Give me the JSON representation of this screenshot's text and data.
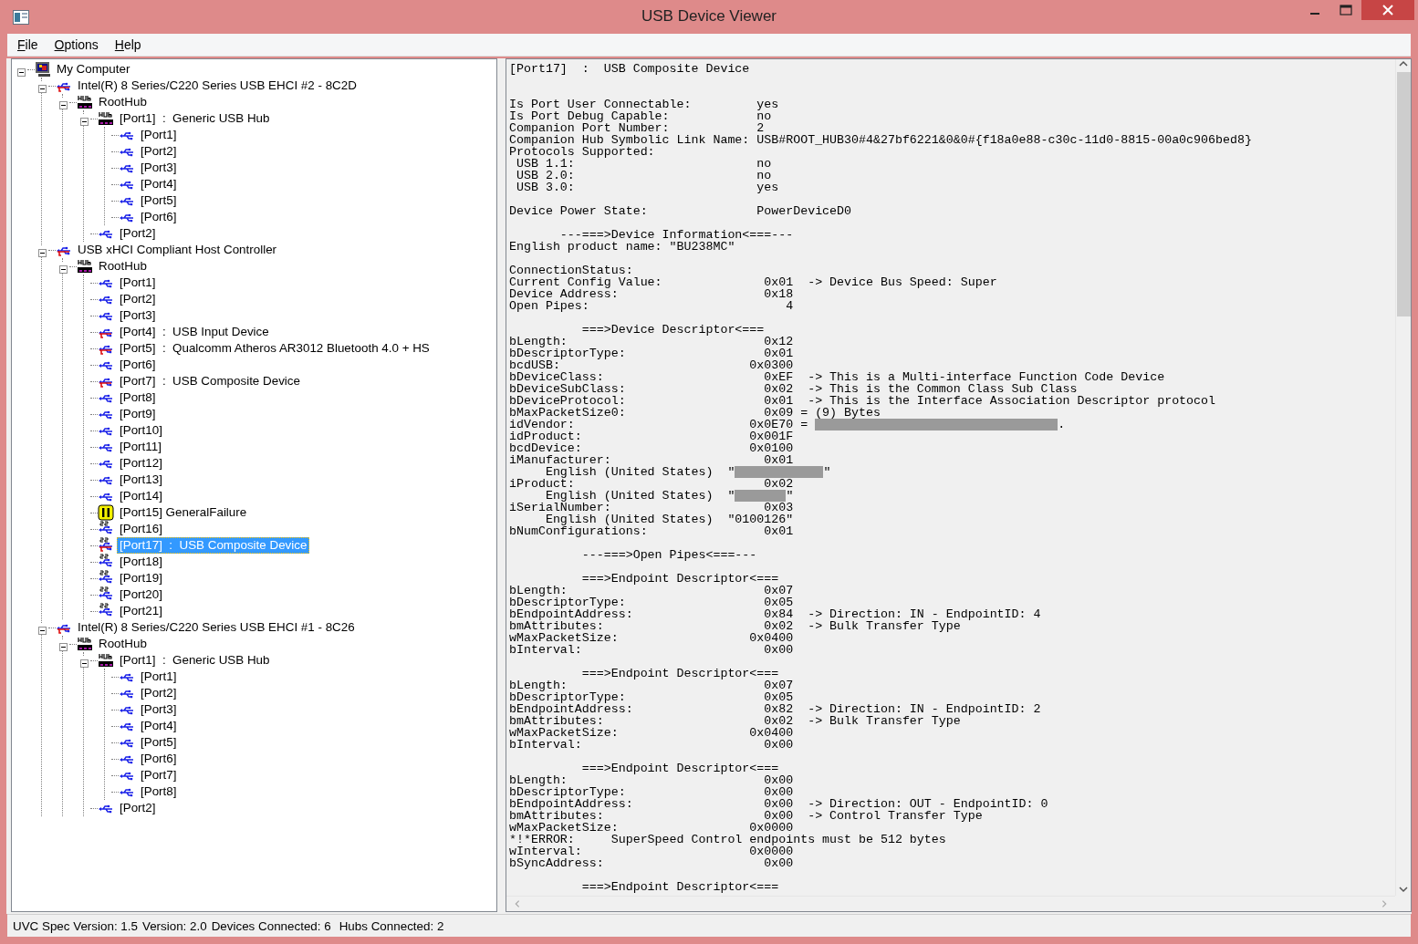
{
  "window": {
    "title": "USB Device Viewer"
  },
  "menu": [
    {
      "label": "File"
    },
    {
      "label": "Options"
    },
    {
      "label": "Help"
    }
  ],
  "tree": [
    {
      "label": "My Computer",
      "kind": "computer",
      "selected": false,
      "expanded": true,
      "children": [
        {
          "label": "Intel(R) 8 Series/C220 Series USB EHCI #2 - 8C2D",
          "kind": "controller",
          "selected": false,
          "expanded": true,
          "children": [
            {
              "label": "RootHub",
              "kind": "hub",
              "selected": false,
              "expanded": true,
              "children": [
                {
                  "label": "[Port1]  :  Generic USB Hub",
                  "kind": "hub",
                  "selected": false,
                  "expanded": true,
                  "children": [
                    {
                      "label": "[Port1]",
                      "kind": "port",
                      "selected": false
                    },
                    {
                      "label": "[Port2]",
                      "kind": "port",
                      "selected": false
                    },
                    {
                      "label": "[Port3]",
                      "kind": "port",
                      "selected": false
                    },
                    {
                      "label": "[Port4]",
                      "kind": "port",
                      "selected": false
                    },
                    {
                      "label": "[Port5]",
                      "kind": "port",
                      "selected": false
                    },
                    {
                      "label": "[Port6]",
                      "kind": "port",
                      "selected": false
                    }
                  ]
                },
                {
                  "label": "[Port2]",
                  "kind": "port",
                  "selected": false
                }
              ]
            }
          ]
        },
        {
          "label": "USB xHCI Compliant Host Controller",
          "kind": "controller",
          "selected": false,
          "expanded": true,
          "children": [
            {
              "label": "RootHub",
              "kind": "hub",
              "selected": false,
              "expanded": true,
              "children": [
                {
                  "label": "[Port1]",
                  "kind": "port",
                  "selected": false
                },
                {
                  "label": "[Port2]",
                  "kind": "port",
                  "selected": false
                },
                {
                  "label": "[Port3]",
                  "kind": "port",
                  "selected": false
                },
                {
                  "label": "[Port4]  :  USB Input Device",
                  "kind": "device",
                  "selected": false
                },
                {
                  "label": "[Port5]  :  Qualcomm Atheros AR3012 Bluetooth 4.0 + HS",
                  "kind": "device",
                  "selected": false
                },
                {
                  "label": "[Port6]",
                  "kind": "port",
                  "selected": false
                },
                {
                  "label": "[Port7]  :  USB Composite Device",
                  "kind": "device",
                  "selected": false
                },
                {
                  "label": "[Port8]",
                  "kind": "port",
                  "selected": false
                },
                {
                  "label": "[Port9]",
                  "kind": "port",
                  "selected": false
                },
                {
                  "label": "[Port10]",
                  "kind": "port",
                  "selected": false
                },
                {
                  "label": "[Port11]",
                  "kind": "port",
                  "selected": false
                },
                {
                  "label": "[Port12]",
                  "kind": "port",
                  "selected": false
                },
                {
                  "label": "[Port13]",
                  "kind": "port",
                  "selected": false
                },
                {
                  "label": "[Port14]",
                  "kind": "port",
                  "selected": false
                },
                {
                  "label": "[Port15] GeneralFailure",
                  "kind": "failure",
                  "selected": false
                },
                {
                  "label": "[Port16]",
                  "kind": "ss-port",
                  "selected": false
                },
                {
                  "label": "[Port17]  :  USB Composite Device",
                  "kind": "ss-device",
                  "selected": true
                },
                {
                  "label": "[Port18]",
                  "kind": "ss-port",
                  "selected": false
                },
                {
                  "label": "[Port19]",
                  "kind": "ss-port",
                  "selected": false
                },
                {
                  "label": "[Port20]",
                  "kind": "ss-port",
                  "selected": false
                },
                {
                  "label": "[Port21]",
                  "kind": "ss-port",
                  "selected": false
                }
              ]
            }
          ]
        },
        {
          "label": "Intel(R) 8 Series/C220 Series USB EHCI #1 - 8C26",
          "kind": "controller",
          "selected": false,
          "expanded": true,
          "children": [
            {
              "label": "RootHub",
              "kind": "hub",
              "selected": false,
              "expanded": true,
              "children": [
                {
                  "label": "[Port1]  :  Generic USB Hub",
                  "kind": "hub",
                  "selected": false,
                  "expanded": true,
                  "children": [
                    {
                      "label": "[Port1]",
                      "kind": "port",
                      "selected": false
                    },
                    {
                      "label": "[Port2]",
                      "kind": "port",
                      "selected": false
                    },
                    {
                      "label": "[Port3]",
                      "kind": "port",
                      "selected": false
                    },
                    {
                      "label": "[Port4]",
                      "kind": "port",
                      "selected": false
                    },
                    {
                      "label": "[Port5]",
                      "kind": "port",
                      "selected": false
                    },
                    {
                      "label": "[Port6]",
                      "kind": "port",
                      "selected": false
                    },
                    {
                      "label": "[Port7]",
                      "kind": "port",
                      "selected": false
                    },
                    {
                      "label": "[Port8]",
                      "kind": "port",
                      "selected": false
                    }
                  ]
                },
                {
                  "label": "[Port2]",
                  "kind": "port",
                  "selected": false
                }
              ]
            }
          ]
        }
      ]
    }
  ],
  "report": {
    "sections": [
      {
        "kind": "header",
        "lines": [
          {
            "text": "[Port17]  :  USB Composite Device"
          }
        ]
      },
      {
        "kind": "body",
        "lines": [
          {
            "text": "Is Port User Connectable:         yes"
          },
          {
            "text": "Is Port Debug Capable:            no"
          },
          {
            "text": "Companion Port Number:            2"
          },
          {
            "text": "Companion Hub Symbolic Link Name: USB#ROOT_HUB30#4&27bf6221&0&0#{f18a0e88-c30c-11d0-8815-00a0c906bed8}"
          },
          {
            "text": "Protocols Supported:"
          },
          {
            "text": " USB 1.1:                         no"
          },
          {
            "text": " USB 2.0:                         no"
          },
          {
            "text": " USB 3.0:                         yes"
          }
        ]
      },
      {
        "kind": "body",
        "lines": [
          {
            "text": "Device Power State:               PowerDeviceD0"
          }
        ]
      },
      {
        "kind": "body",
        "lines": [
          {
            "text": "       ---===>Device Information<===---"
          },
          {
            "text": "English product name: \"BU238MC\""
          }
        ]
      },
      {
        "kind": "body",
        "lines": [
          {
            "text": "ConnectionStatus:"
          },
          {
            "text": "Current Config Value:              0x01  -> Device Bus Speed: Super"
          },
          {
            "text": "Device Address:                    0x18"
          },
          {
            "text": "Open Pipes:                           4"
          }
        ]
      },
      {
        "kind": "body",
        "lines": [
          {
            "text": "          ===>Device Descriptor<==="
          },
          {
            "text": "bLength:                           0x12"
          },
          {
            "text": "bDescriptorType:                   0x01"
          },
          {
            "text": "bcdUSB:                          0x0300"
          },
          {
            "text": "bDeviceClass:                      0xEF  -> This is a Multi-interface Function Code Device"
          },
          {
            "text": "bDeviceSubClass:                   0x02  -> This is the Common Class Sub Class"
          },
          {
            "text": "bDeviceProtocol:                   0x01  -> This is the Interface Association Descriptor protocol"
          },
          {
            "text": "bMaxPacketSize0:                   0x09 = (9) Bytes"
          },
          {
            "text": "idVendor:                        0x0E70 = ",
            "kind": "redacted-long",
            "after": "."
          },
          {
            "text": "idProduct:                       0x001F"
          },
          {
            "text": "bcdDevice:                       0x0100"
          },
          {
            "text": "iManufacturer:                     0x01"
          },
          {
            "text": "     English (United States)  \"",
            "kind": "redacted-medium",
            "after": "\""
          },
          {
            "text": "iProduct:                          0x02"
          },
          {
            "text": "     English (United States)  \"",
            "kind": "redacted-short",
            "after": "\""
          },
          {
            "text": "iSerialNumber:                     0x03"
          },
          {
            "text": "     English (United States)  \"0100126\""
          },
          {
            "text": "bNumConfigurations:                0x01"
          }
        ]
      },
      {
        "kind": "body",
        "lines": [
          {
            "text": "          ---===>Open Pipes<===---"
          }
        ]
      },
      {
        "kind": "body",
        "lines": [
          {
            "text": "          ===>Endpoint Descriptor<==="
          },
          {
            "text": "bLength:                           0x07"
          },
          {
            "text": "bDescriptorType:                   0x05"
          },
          {
            "text": "bEndpointAddress:                  0x84  -> Direction: IN - EndpointID: 4"
          },
          {
            "text": "bmAttributes:                      0x02  -> Bulk Transfer Type"
          },
          {
            "text": "wMaxPacketSize:                  0x0400"
          },
          {
            "text": "bInterval:                         0x00"
          }
        ]
      },
      {
        "kind": "body",
        "lines": [
          {
            "text": "          ===>Endpoint Descriptor<==="
          },
          {
            "text": "bLength:                           0x07"
          },
          {
            "text": "bDescriptorType:                   0x05"
          },
          {
            "text": "bEndpointAddress:                  0x82  -> Direction: IN - EndpointID: 2"
          },
          {
            "text": "bmAttributes:                      0x02  -> Bulk Transfer Type"
          },
          {
            "text": "wMaxPacketSize:                  0x0400"
          },
          {
            "text": "bInterval:                         0x00"
          }
        ]
      },
      {
        "kind": "body",
        "lines": [
          {
            "text": "          ===>Endpoint Descriptor<==="
          },
          {
            "text": "bLength:                           0x00"
          },
          {
            "text": "bDescriptorType:                   0x00"
          },
          {
            "text": "bEndpointAddress:                  0x00  -> Direction: OUT - EndpointID: 0"
          },
          {
            "text": "bmAttributes:                      0x00  -> Control Transfer Type"
          },
          {
            "text": "wMaxPacketSize:                  0x0000"
          },
          {
            "text": "*!*ERROR:     SuperSpeed Control endpoints must be 512 bytes"
          },
          {
            "text": "wInterval:                       0x0000"
          },
          {
            "text": "bSyncAddress:                      0x00"
          }
        ]
      },
      {
        "kind": "body",
        "lines": [
          {
            "text": "          ===>Endpoint Descriptor<==="
          }
        ]
      }
    ]
  },
  "status_bar": [
    {
      "text": "UVC Spec Version: 1.5"
    },
    {
      "text": "Version: 2.0"
    },
    {
      "text": "Devices Connected: 6"
    },
    {
      "text": "Hubs Connected: 2"
    }
  ]
}
